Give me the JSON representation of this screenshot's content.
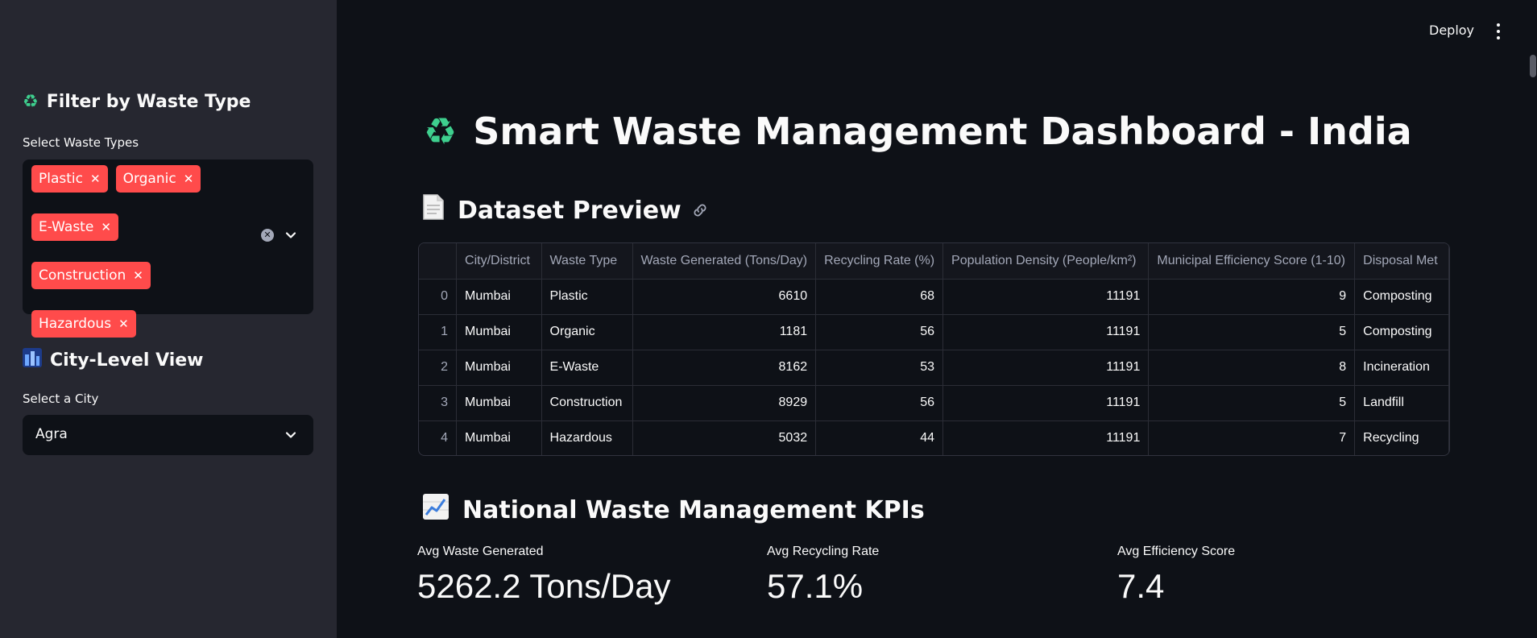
{
  "sidebar": {
    "filter_header": "Filter by Waste Type",
    "filter_label": "Select Waste Types",
    "chips": [
      {
        "label": "Plastic"
      },
      {
        "label": "Organic"
      },
      {
        "label": "E-Waste"
      },
      {
        "label": "Construction"
      },
      {
        "label": "Hazardous"
      }
    ],
    "city_header": "City-Level View",
    "city_label": "Select a City",
    "city_value": "Agra"
  },
  "header": {
    "deploy_label": "Deploy"
  },
  "main": {
    "title": "Smart Waste Management Dashboard - India",
    "dataset_title": "Dataset Preview",
    "table": {
      "columns": [
        "",
        "City/District",
        "Waste Type",
        "Waste Generated (Tons/Day)",
        "Recycling Rate (%)",
        "Population Density (People/km²)",
        "Municipal Efficiency Score (1-10)",
        "Disposal Met"
      ],
      "rows": [
        [
          "0",
          "Mumbai",
          "Plastic",
          "6610",
          "68",
          "11191",
          "9",
          "Composting"
        ],
        [
          "1",
          "Mumbai",
          "Organic",
          "1181",
          "56",
          "11191",
          "5",
          "Composting"
        ],
        [
          "2",
          "Mumbai",
          "E-Waste",
          "8162",
          "53",
          "11191",
          "8",
          "Incineration"
        ],
        [
          "3",
          "Mumbai",
          "Construction",
          "8929",
          "56",
          "11191",
          "5",
          "Landfill"
        ],
        [
          "4",
          "Mumbai",
          "Hazardous",
          "5032",
          "44",
          "11191",
          "7",
          "Recycling"
        ]
      ]
    },
    "kpi_title": "National Waste Management KPIs",
    "kpis": [
      {
        "label": "Avg Waste Generated",
        "value": "5262.2 Tons/Day"
      },
      {
        "label": "Avg Recycling Rate",
        "value": "57.1%"
      },
      {
        "label": "Avg Efficiency Score",
        "value": "7.4"
      }
    ]
  },
  "colors": {
    "accent": "#ff4b4b",
    "background": "#0e1117",
    "sidebar": "#262730"
  },
  "icons": {
    "recycle": "recycle-icon",
    "cityscape": "cityscape-icon",
    "document": "document-icon",
    "chart": "chart-increasing-icon"
  }
}
